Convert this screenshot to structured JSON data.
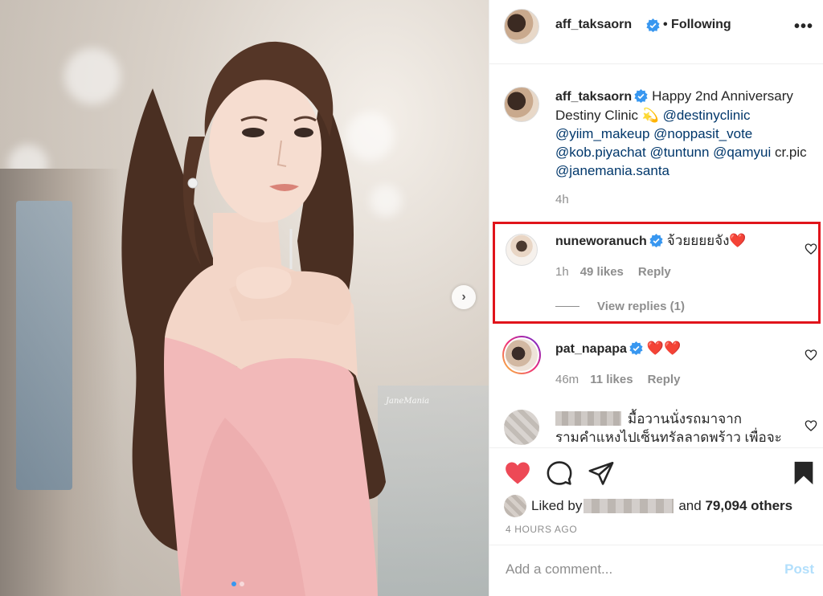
{
  "post": {
    "author": "aff_taksaorn",
    "follow_status": "• Following",
    "more_label": "•••",
    "caption_parts": {
      "text1": "Happy 2nd Anniversary Destiny Clinic 💫 ",
      "m1": "@destinyclinic",
      "m2": "@yiim_makeup",
      "m3": "@noppasit_vote",
      "m4": "@kob.piyachat",
      "m5": "@tuntunn",
      "m6": "@qamyui",
      "text2": "cr.pic ",
      "m7": "@janemania.santa"
    },
    "caption_time": "4h",
    "watermark": "JaneMania"
  },
  "comments": [
    {
      "username": "nuneworanuch",
      "text": "จ้วยยยยจัง❤️",
      "time": "1h",
      "likes": "49 likes",
      "reply_label": "Reply",
      "view_replies": "View replies (1)"
    },
    {
      "username": "pat_napapa",
      "text": "❤️❤️",
      "time": "46m",
      "likes": "11 likes",
      "reply_label": "Reply"
    },
    {
      "username": "",
      "text_line1": "มื้อวานนั่งรถมาจาก",
      "text_line2": "รามคำแหงไปเซ็นทรัลลาดพร้าว เพื่อจะ"
    }
  ],
  "likes": {
    "liked_by_prefix": "Liked by",
    "and_text": "and",
    "others": "79,094 others"
  },
  "timestamp": "4 HOURS AGO",
  "add_comment": {
    "placeholder": "Add a comment...",
    "post_label": "Post"
  },
  "colors": {
    "heart_red": "#ed4956",
    "verified_blue": "#3897f0",
    "highlight_red": "#e0141b",
    "post_disabled": "#b2dffc"
  },
  "icons": [
    "heart-icon",
    "comment-icon",
    "share-icon",
    "bookmark-icon",
    "verified-icon",
    "chevron-right-icon",
    "more-icon"
  ]
}
